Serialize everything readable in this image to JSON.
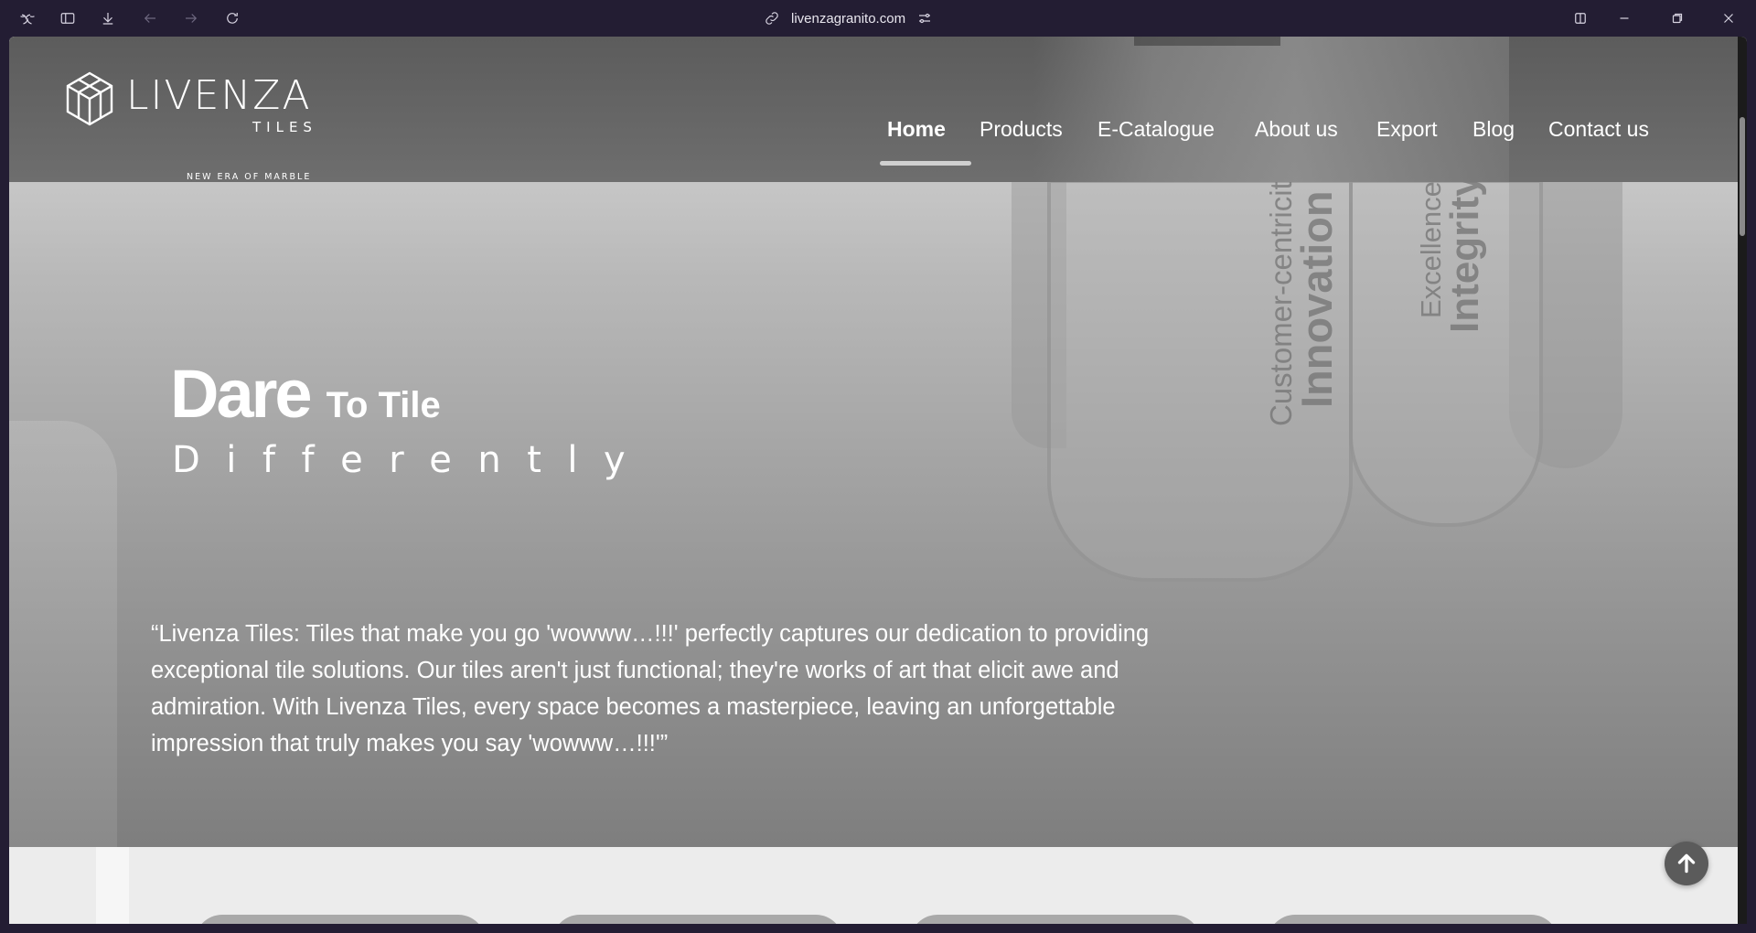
{
  "browser": {
    "url": "livenzagranito.com",
    "icons": [
      "leaf-logo-icon",
      "sidebar-icon",
      "download-icon",
      "back-icon",
      "forward-icon",
      "reload-icon",
      "link-icon",
      "site-settings-icon",
      "split-view-icon",
      "minimize-icon",
      "restore-icon",
      "close-icon"
    ]
  },
  "logo": {
    "name": "LIVENZA",
    "sub": "TILES",
    "tagline": "NEW ERA OF MARBLE"
  },
  "nav": {
    "items": [
      {
        "label": "Home",
        "active": true
      },
      {
        "label": "Products"
      },
      {
        "label": "E-Catalogue"
      },
      {
        "label": "About us"
      },
      {
        "label": "Export"
      },
      {
        "label": "Blog"
      },
      {
        "label": "Contact us"
      }
    ]
  },
  "pillars": {
    "words": [
      "Customer-centricity",
      "Innovation",
      "Excellence",
      "Integrity"
    ]
  },
  "hero": {
    "title_bold": "Dare",
    "title_light": "To Tile",
    "subtitle": "Differently",
    "quote": "“Livenza Tiles: Tiles that make you go 'wowww…!!!' perfectly captures our dedication to providing exceptional tile solutions. Our tiles aren't just functional; they're works of art that elicit awe and admiration. With Livenza Tiles, every space becomes a masterpiece, leaving an unforgettable impression that truly makes you say 'wowww…!!!'”"
  },
  "colors": {
    "browser_bg": "#231d33",
    "header_bg": "#5c5c5c",
    "text_white": "#ffffff"
  }
}
